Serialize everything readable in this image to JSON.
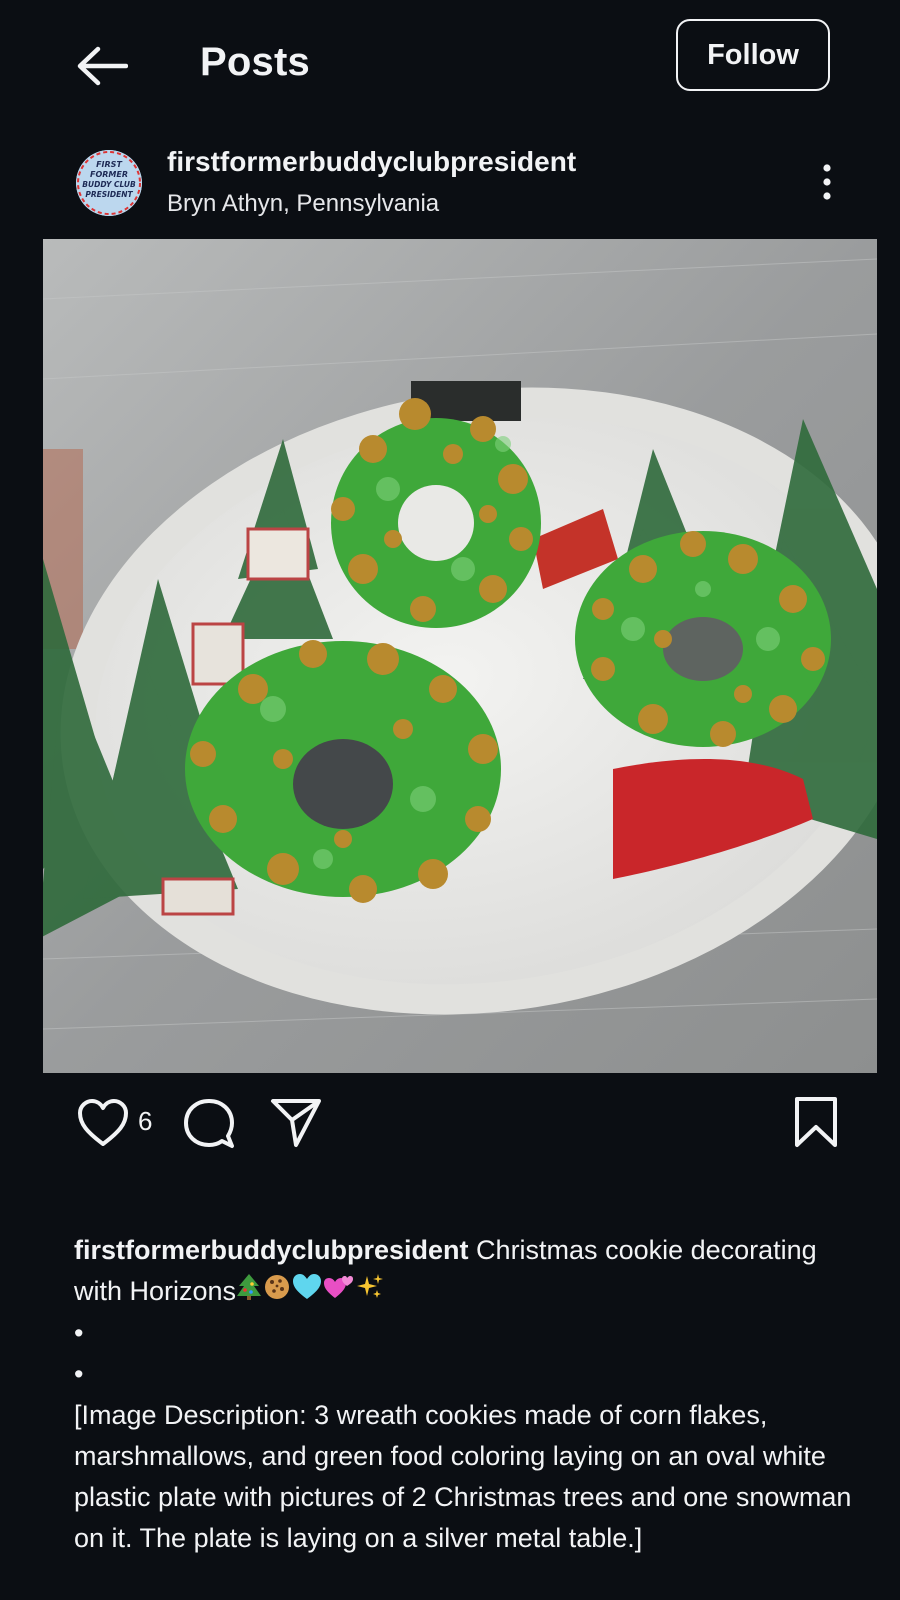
{
  "header": {
    "title": "Posts",
    "back_icon": "arrow-left-icon",
    "follow_label": "Follow"
  },
  "post": {
    "username": "firstformerbuddyclubpresident",
    "location": "Bryn Athyn, Pennsylvania",
    "avatar_text": [
      "FIRST",
      "FORMER",
      "BUDDY CLUB",
      "PRESIDENT"
    ],
    "like_count": "6",
    "icons": {
      "like": "heart-outline-icon",
      "comment": "speech-bubble-icon",
      "share": "paper-plane-icon",
      "save": "bookmark-outline-icon",
      "more": "three-dots-vertical-icon"
    },
    "caption": {
      "username": "firstformerbuddyclubpresident",
      "text": " Christmas cookie decorating with Horizons",
      "emojis": [
        "christmas-tree-emoji",
        "cookie-emoji",
        "light-blue-heart-emoji",
        "revolving-hearts-emoji",
        "sparkles-emoji"
      ],
      "bullet1": "•",
      "bullet2": "•",
      "description": "[Image Description: 3 wreath cookies made of corn flakes, marshmallows, and green food coloring laying on an oval white plastic plate with pictures of 2 Christmas trees and one snowman on it. The plate is laying on a silver metal table.]"
    }
  },
  "colors": {
    "background": "#0b0e13",
    "text": "#f2f3f5",
    "wreath_green": "#3fa83a",
    "cornflake": "#b88a2e",
    "table_silver": "#a3a6a7"
  }
}
